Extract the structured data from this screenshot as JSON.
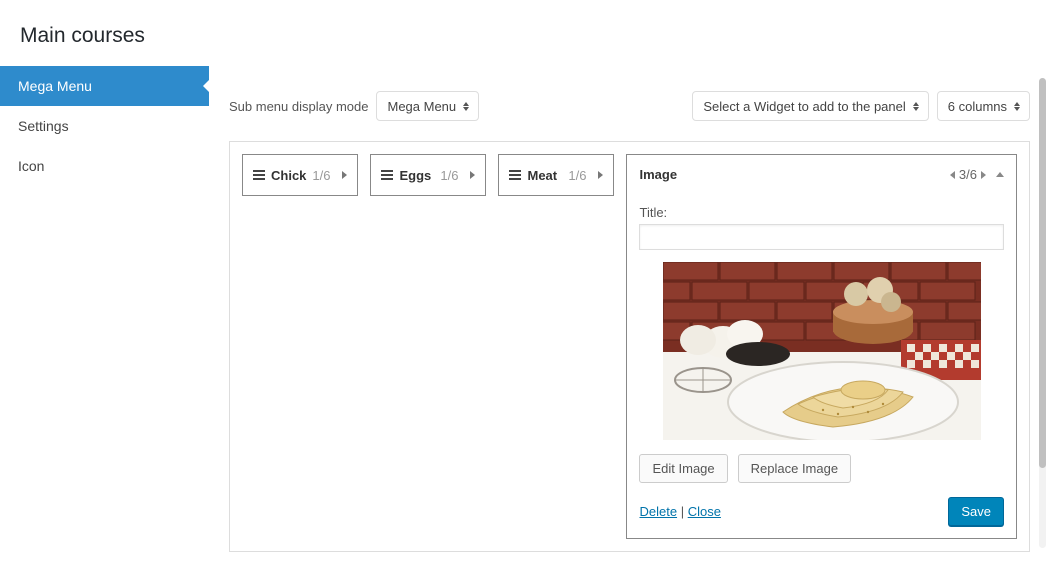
{
  "header": {
    "title": "Main courses"
  },
  "sidebar": {
    "items": [
      {
        "label": "Mega Menu",
        "active": true
      },
      {
        "label": "Settings",
        "active": false
      },
      {
        "label": "Icon",
        "active": false
      }
    ]
  },
  "controls": {
    "displayModeLabel": "Sub menu display mode",
    "displayModeValue": "Mega Menu",
    "widgetSelectValue": "Select a Widget to add to the panel",
    "columnsValue": "6 columns"
  },
  "menuItems": [
    {
      "label": "Chick",
      "fraction": "1/6"
    },
    {
      "label": "Eggs",
      "fraction": "1/6"
    },
    {
      "label": "Meat",
      "fraction": "1/6"
    }
  ],
  "widget": {
    "title": "Image",
    "position": "3/6",
    "form": {
      "titleLabel": "Title:",
      "titleValue": "",
      "editImage": "Edit Image",
      "replaceImage": "Replace Image",
      "deleteLink": "Delete",
      "closeLink": "Close",
      "separator": " | ",
      "save": "Save"
    }
  }
}
